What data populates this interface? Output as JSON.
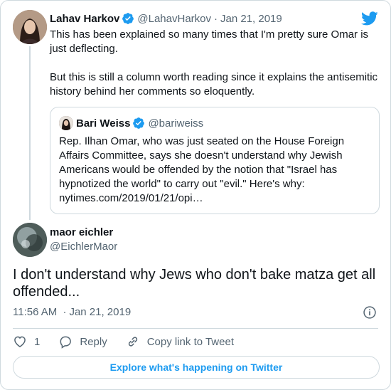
{
  "colors": {
    "accent": "#1d9bf0",
    "text": "#0f1419",
    "muted": "#536471",
    "border": "#cfd9de"
  },
  "parent": {
    "name": "Lahav Harkov",
    "handle": "@LahavHarkov",
    "separator": "·",
    "date": "Jan 21, 2019",
    "verified_icon": "verified-badge-icon",
    "paragraphs": [
      "This has been explained so many times that I'm pretty sure Omar is just deflecting.",
      "But this is still a column worth reading since it explains the antisemitic history behind her comments so eloquently."
    ]
  },
  "quote": {
    "name": "Bari Weiss",
    "handle": "@bariweiss",
    "text": "Rep. Ilhan Omar, who was just seated on the House Foreign Affairs Committee, says she doesn't understand why Jewish Americans would be offended by the notion that \"Israel has hypnotized the world\" to carry out \"evil.\" Here's why: nytimes.com/2019/01/21/opi…"
  },
  "reply": {
    "name": "maor eichler",
    "handle": "@EichlerMaor",
    "text": "I don't understand why Jews who don't bake matza get all offended...",
    "time": "11:56 AM",
    "separator": "·",
    "date": "Jan 21, 2019"
  },
  "actions": {
    "like_count": "1",
    "reply_label": "Reply",
    "copy_label": "Copy link to Tweet"
  },
  "footer": {
    "explore_label": "Explore what's happening on Twitter"
  },
  "icons": [
    "twitter-logo-icon",
    "verified-badge-icon",
    "info-icon",
    "heart-icon",
    "reply-icon",
    "link-icon"
  ]
}
